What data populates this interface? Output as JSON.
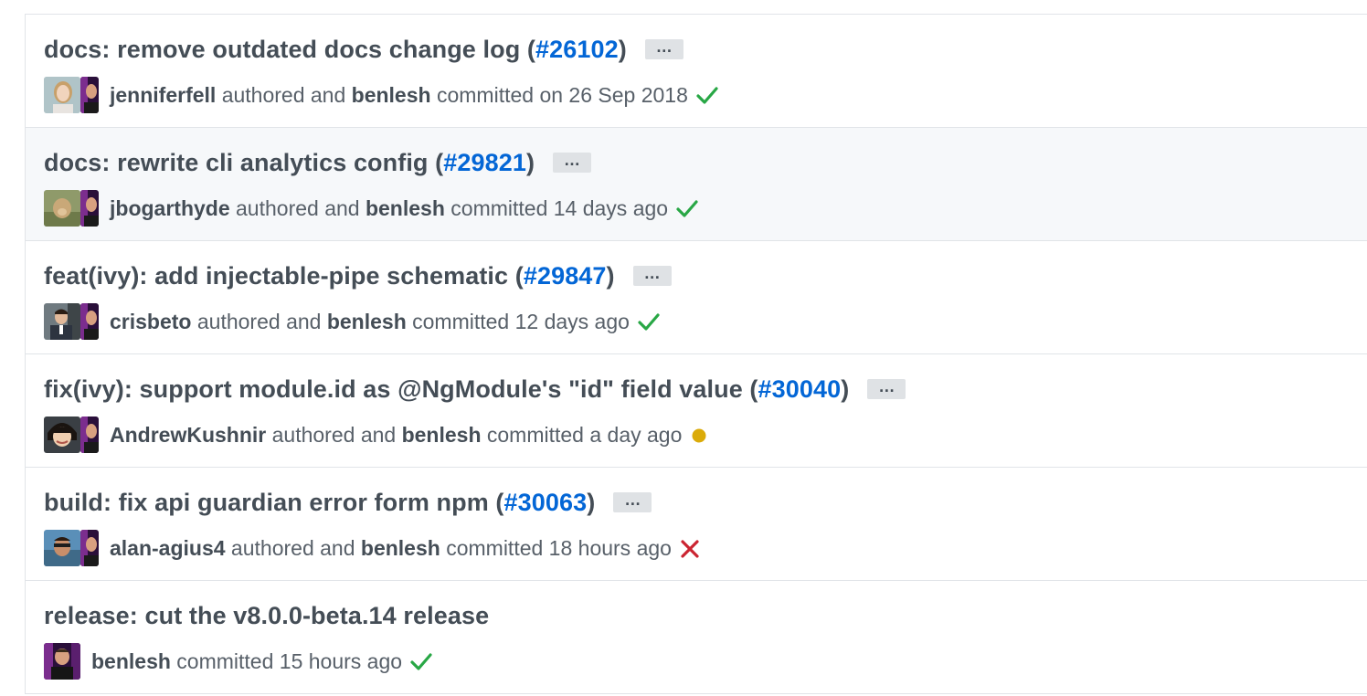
{
  "commits": [
    {
      "message": "docs: remove outdated docs change log (",
      "pr": "#26102",
      "close": ")",
      "author": "jenniferfell",
      "authored_text": " authored and ",
      "committer": "benlesh",
      "committed_text": " committed on 26 Sep 2018",
      "status": "success",
      "ellipsis": "…",
      "highlighted": false
    },
    {
      "message": "docs: rewrite cli analytics config (",
      "pr": "#29821",
      "close": ")",
      "author": "jbogarthyde",
      "authored_text": " authored and ",
      "committer": "benlesh",
      "committed_text": " committed 14 days ago",
      "status": "success",
      "ellipsis": "…",
      "highlighted": true
    },
    {
      "message": "feat(ivy): add injectable-pipe schematic (",
      "pr": "#29847",
      "close": ")",
      "author": "crisbeto",
      "authored_text": " authored and ",
      "committer": "benlesh",
      "committed_text": " committed 12 days ago",
      "status": "success",
      "ellipsis": "…",
      "highlighted": false
    },
    {
      "message": "fix(ivy): support module.id as @NgModule's \"id\" field value (",
      "pr": "#30040",
      "close": ")",
      "author": "AndrewKushnir",
      "authored_text": " authored and ",
      "committer": "benlesh",
      "committed_text": " committed a day ago",
      "status": "pending",
      "ellipsis": "…",
      "highlighted": false
    },
    {
      "message": "build: fix api guardian error form npm (",
      "pr": "#30063",
      "close": ")",
      "author": "alan-agius4",
      "authored_text": " authored and ",
      "committer": "benlesh",
      "committed_text": " committed 18 hours ago",
      "status": "failure",
      "ellipsis": "…",
      "highlighted": false
    },
    {
      "message": "release: cut the v8.0.0-beta.14 release",
      "committer": "benlesh",
      "committed_text": " committed 15 hours ago",
      "status": "success",
      "highlighted": false
    }
  ],
  "colors": {
    "success": "#28a745",
    "pending": "#dbab09",
    "failure": "#cb2431",
    "link": "#0366d6"
  }
}
